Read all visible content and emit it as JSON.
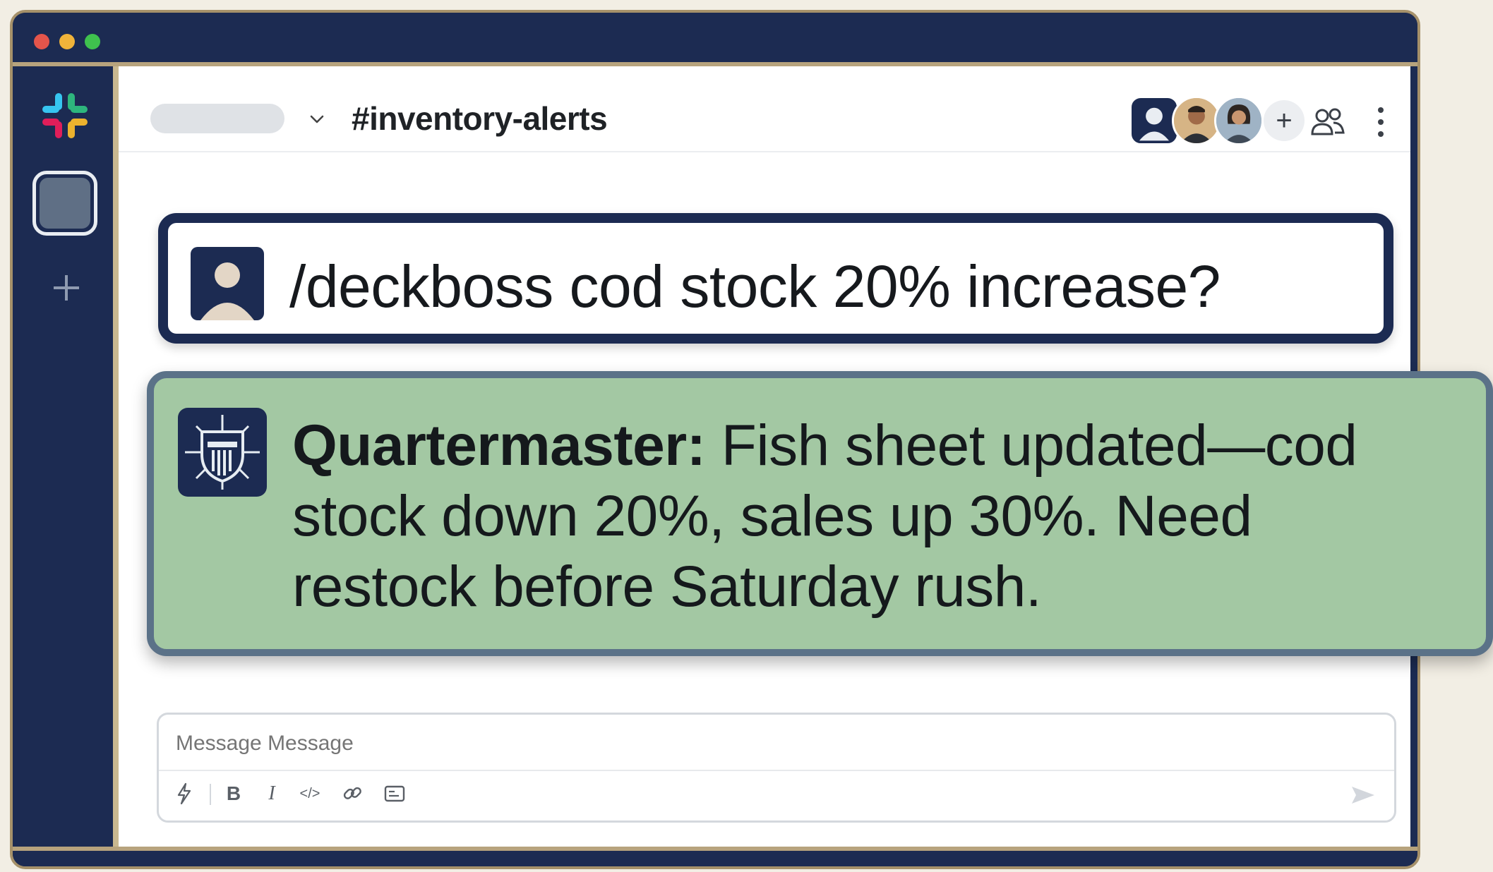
{
  "window": {
    "controls": [
      "close",
      "minimize",
      "zoom"
    ]
  },
  "sidebar": {
    "logo_icon": "slack-logo-icon",
    "workspace_icon": "workspace-icon",
    "add_icon": "plus-icon"
  },
  "header": {
    "workspace_pill": "",
    "channel_name": "#inventory-alerts",
    "add_member_label": "+",
    "icons": [
      "members-icon",
      "more-vertical-icon"
    ]
  },
  "messages": [
    {
      "author_avatar": "user-avatar-icon",
      "text": "/deckboss cod stock 20% increase?"
    },
    {
      "author_avatar": "shield-bot-icon",
      "author": "Quartermaster:",
      "text": "Fish sheet updated—cod stock down 20%, sales up 30%. Need restock before Saturday rush."
    }
  ],
  "composer": {
    "placeholder": "Message Message",
    "toolbar": {
      "bold": "B",
      "italic": "I",
      "code": "</>"
    }
  },
  "colors": {
    "navy": "#1c2b52",
    "bot_card_green": "#a3c8a3",
    "bot_card_border": "#5b7288",
    "frame_gold": "#a6916a"
  }
}
